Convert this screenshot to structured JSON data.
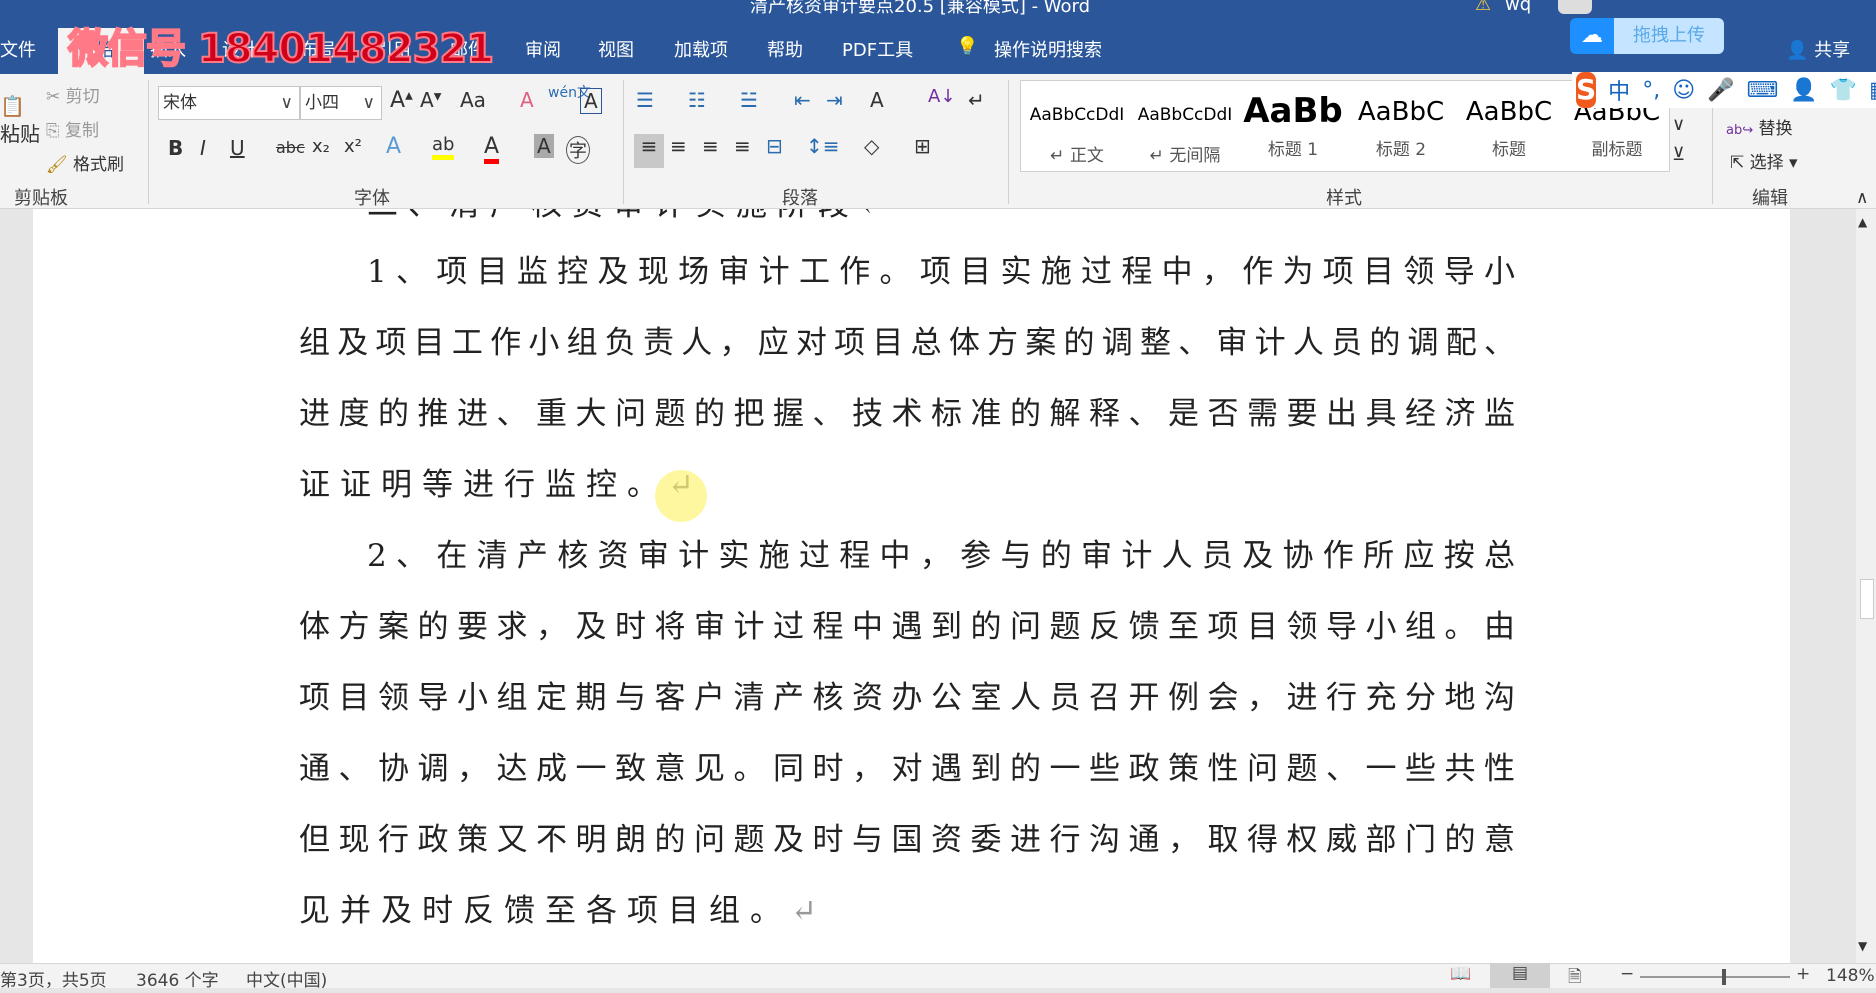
{
  "window": {
    "title": "清产核资审计要点20.5 [兼容模式] - Word",
    "user": "wq"
  },
  "tabs": [
    "文件",
    "开始",
    "插入",
    "设计",
    "布局",
    "引用",
    "邮件",
    "审阅",
    "视图",
    "加载项",
    "帮助",
    "PDF工具"
  ],
  "tell_me": "操作说明搜索",
  "share": "共享",
  "upload_label": "拖拽上传",
  "watermark": "微信号 18401482321",
  "clipboard": {
    "paste": "粘贴",
    "cut": "剪切",
    "copy": "复制",
    "format_painter": "格式刷",
    "label": "剪贴板"
  },
  "font": {
    "name": "宋体",
    "size": "小四",
    "label": "字体",
    "case": "Aa",
    "bold": "B",
    "italic": "I",
    "underline": "U",
    "strike": "abc",
    "sub": "x₂",
    "sup": "x²",
    "phonetic": "wén文",
    "border_char": "A",
    "text_color": "#ff0000",
    "highlight_color": "#ffff00"
  },
  "paragraph": {
    "label": "段落"
  },
  "styles": {
    "label": "样式",
    "items": [
      {
        "sample": "AaBbCcDdI",
        "name": "↵ 正文"
      },
      {
        "sample": "AaBbCcDdI",
        "name": "↵ 无间隔"
      },
      {
        "sample": "AaBb",
        "name": "标题 1"
      },
      {
        "sample": "AaBbC",
        "name": "标题 2"
      },
      {
        "sample": "AaBbC",
        "name": "标题"
      },
      {
        "sample": "AaBbC",
        "name": "副标题"
      }
    ]
  },
  "editing": {
    "replace": "替换",
    "select": "选择",
    "label": "编辑"
  },
  "ime": {
    "logo": "S",
    "mode": "中",
    "punct": "°,"
  },
  "document": {
    "heading_partial": "二、清产核资审计实施阶段↵",
    "paragraphs": [
      {
        "lines": [
          "1、项目监控及现场审计工作。项目实施过程中，作为项目领导小",
          "组及项目工作小组负责人，应对项目总体方案的调整、审计人员的调配、",
          "进度的推进、重大问题的把握、技术标准的解释、是否需要出具经济监",
          "证证明等进行监控。"
        ],
        "mark": "↵"
      },
      {
        "lines": [
          "2、在清产核资审计实施过程中，参与的审计人员及协作所应按总",
          "体方案的要求，及时将审计过程中遇到的问题反馈至项目领导小组。由",
          "项目领导小组定期与客户清产核资办公室人员召开例会，进行充分地沟",
          "通、协调，达成一致意见。同时，对遇到的一些政策性问题、一些共性",
          "但现行政策又不明朗的问题及时与国资委进行沟通，取得权威部门的意",
          "见并及时反馈至各项目组。"
        ],
        "mark": "↵"
      }
    ]
  },
  "status": {
    "page": "第3页，共5页",
    "words": "3646 个字",
    "language": "中文(中国)",
    "zoom": "148%",
    "zoom_percent": 148
  }
}
